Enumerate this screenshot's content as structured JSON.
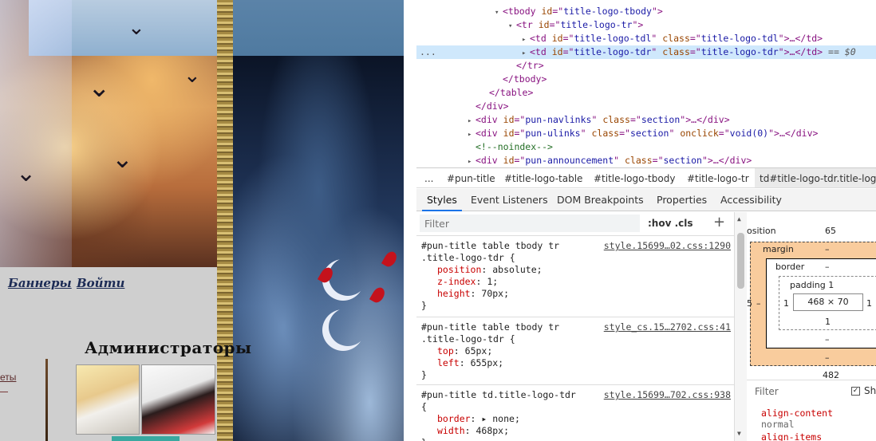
{
  "page": {
    "nav": {
      "banners": "Баннеры",
      "login": "Войти"
    },
    "admins_title": "Администраторы",
    "left_link": "еты"
  },
  "devtools": {
    "tree": [
      {
        "indent": 0,
        "tri": "▾",
        "open": "tbody",
        "attrs": [
          [
            "id",
            "title-logo-tbody"
          ]
        ],
        "tail": ""
      },
      {
        "indent": 1,
        "tri": "▾",
        "open": "tr",
        "attrs": [
          [
            "id",
            "title-logo-tr"
          ]
        ],
        "tail": ""
      },
      {
        "indent": 2,
        "tri": "▸",
        "open": "td",
        "attrs": [
          [
            "id",
            "title-logo-tdl"
          ],
          [
            "class",
            "title-logo-tdl"
          ]
        ],
        "tail": "…</td>"
      },
      {
        "indent": 2,
        "tri": "▸",
        "open": "td",
        "attrs": [
          [
            "id",
            "title-logo-tdr"
          ],
          [
            "class",
            "title-logo-tdr"
          ]
        ],
        "tail": "…</td>",
        "selected": true,
        "eq": "== $0"
      },
      {
        "indent": 1,
        "tri": "",
        "close": "tr"
      },
      {
        "indent": 0,
        "tri": "",
        "close": "tbody"
      },
      {
        "indent": -1,
        "tri": "",
        "close": "table"
      },
      {
        "indent": -2,
        "tri": "",
        "close": "div"
      },
      {
        "indent": -2,
        "tri": "▸",
        "open": "div",
        "attrs": [
          [
            "id",
            "pun-navlinks"
          ],
          [
            "class",
            "section"
          ]
        ],
        "tail": "…</div>"
      },
      {
        "indent": -2,
        "tri": "▸",
        "open": "div",
        "attrs": [
          [
            "id",
            "pun-ulinks"
          ],
          [
            "class",
            "section"
          ],
          [
            "onclick",
            "void(0)"
          ]
        ],
        "tail": "…</div>"
      },
      {
        "indent": -2,
        "tri": "",
        "comment": "<!--noindex-->"
      },
      {
        "indent": -2,
        "tri": "▸",
        "open": "div",
        "attrs": [
          [
            "id",
            "pun-announcement"
          ],
          [
            "class",
            "section"
          ]
        ],
        "tail": "…</div>"
      }
    ],
    "dots": "...",
    "crumbs": [
      "...",
      "#pun-title",
      "#title-logo-table",
      "#title-logo-tbody",
      "#title-logo-tr",
      "td#title-logo-tdr.title-log"
    ],
    "tabs": [
      "Styles",
      "Event Listeners",
      "DOM Breakpoints",
      "Properties",
      "Accessibility"
    ],
    "filter_placeholder": "Filter",
    "hov_cls": ":hov .cls",
    "plus": "+",
    "rules": [
      {
        "selector": [
          "#pun-title table tbody tr",
          ".title-logo-tdr {"
        ],
        "source": "style.15699…02.css:1290",
        "decls": [
          [
            "position",
            "absolute;"
          ],
          [
            "z-index",
            "1;"
          ],
          [
            "height",
            "70px;"
          ]
        ]
      },
      {
        "selector": [
          "#pun-title table tbody tr",
          ".title-logo-tdr {"
        ],
        "source": "style_cs.15…2702.css:41",
        "decls": [
          [
            "top",
            "65px;"
          ],
          [
            "left",
            "655px;"
          ]
        ]
      },
      {
        "selector": [
          "#pun-title td.title-logo-tdr",
          "{"
        ],
        "source": "style.15699…702.css:938",
        "decls": [
          [
            "border",
            "▸ none;"
          ],
          [
            "width",
            "468px;"
          ]
        ]
      }
    ],
    "boxmodel": {
      "position_label": "osition",
      "position_top": "65",
      "margin_label": "margin",
      "margin_top": "–",
      "margin_bottom": "–",
      "margin_left": "–",
      "border_label": "border",
      "border_top": "–",
      "border_bottom": "–",
      "padding_label": "padding 1",
      "padding_left": "1",
      "padding_right": "1",
      "padding_bottom": "1",
      "content": "468 × 70",
      "position_bottom": "482",
      "left_edge": "5"
    },
    "computed": {
      "filter": "Filter",
      "show_all": "Sh",
      "props": [
        [
          "align-content",
          "normal"
        ],
        [
          "align-items",
          ""
        ]
      ]
    }
  }
}
